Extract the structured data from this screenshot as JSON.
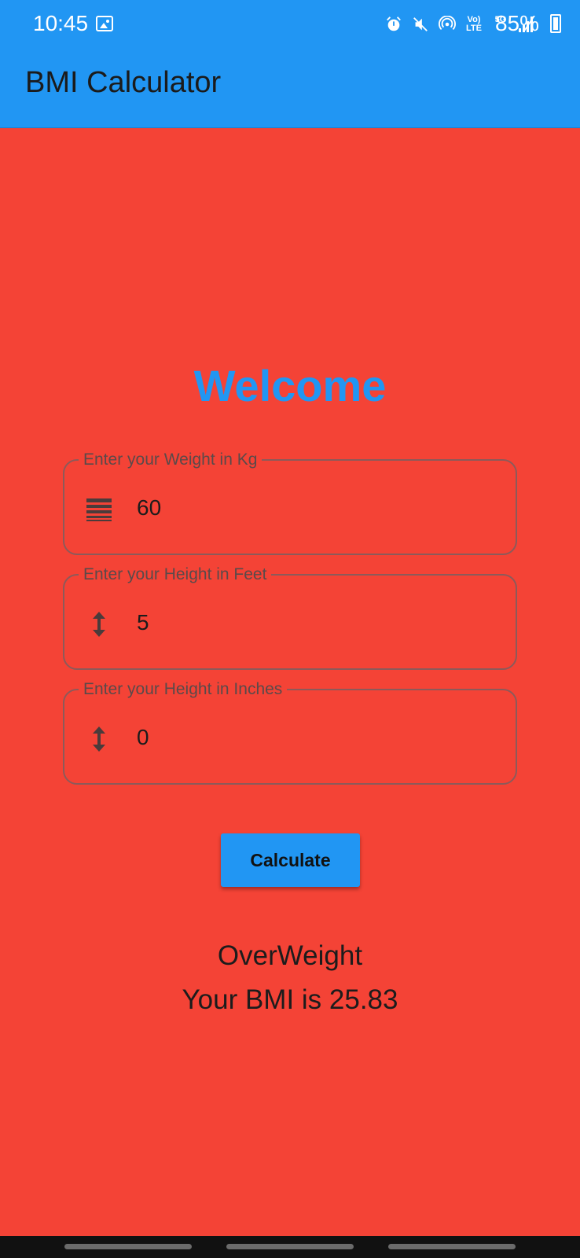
{
  "status_bar": {
    "time": "10:45",
    "battery": "85%",
    "lte_label": "Vo) LTE",
    "network_label": "5G"
  },
  "app_bar": {
    "title": "BMI Calculator"
  },
  "main": {
    "welcome": "Welcome",
    "fields": [
      {
        "label": "Enter your Weight in Kg",
        "value": "60",
        "icon": "weight-lines-icon"
      },
      {
        "label": "Enter your Height in Feet",
        "value": "5",
        "icon": "vertical-arrows-icon"
      },
      {
        "label": "Enter your Height in Inches",
        "value": "0",
        "icon": "vertical-arrows-icon"
      }
    ],
    "calculate_label": "Calculate",
    "result_status": "OverWeight",
    "result_bmi": "Your BMI is 25.83"
  },
  "colors": {
    "background": "#F44336",
    "accent": "#2196F3"
  }
}
